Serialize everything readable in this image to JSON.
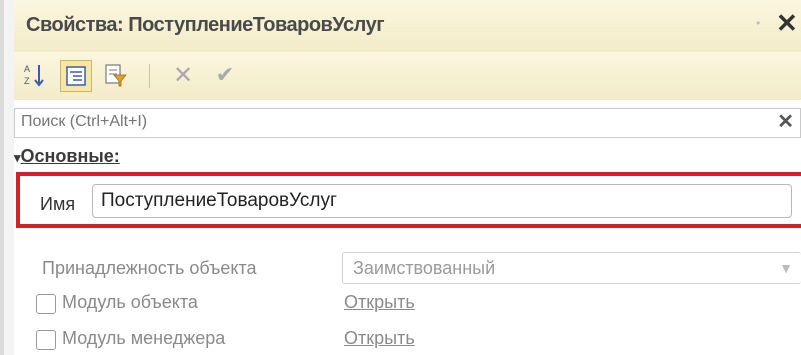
{
  "window": {
    "title": "Свойства: ПоступлениеТоваровУслуг",
    "pin_glyph": "•",
    "close_glyph": "✕"
  },
  "toolbar": {
    "sort_icon": "sort-alphabet-icon",
    "categories_icon": "categories-icon",
    "filter_icon": "filter-icon",
    "delete_glyph": "✕",
    "ok_glyph": "✔"
  },
  "search": {
    "placeholder": "Поиск (Ctrl+Alt+I)",
    "clear_glyph": "✕"
  },
  "group": {
    "arrow": "▾",
    "label": "Основные:"
  },
  "name": {
    "label": "Имя",
    "value": "ПоступлениеТоваровУслуг"
  },
  "owner": {
    "label": "Принадлежность объекта",
    "value": "Заимствованный",
    "arrow": "▼"
  },
  "modules": [
    {
      "label": "Модуль объекта",
      "link": "Открыть",
      "checked": false
    },
    {
      "label": "Модуль менеджера",
      "link": "Открыть",
      "checked": false
    }
  ],
  "colors": {
    "highlight_frame": "#d4202b",
    "header_bg": "#f3ebc9"
  }
}
